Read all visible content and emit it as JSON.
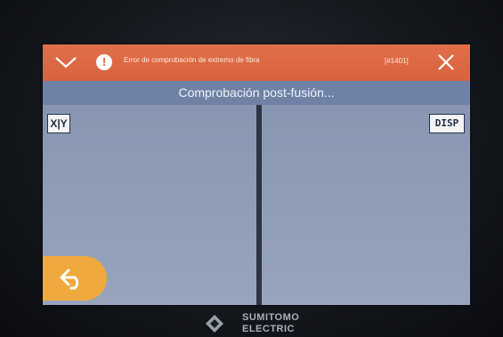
{
  "error_bar": {
    "icon": "chevron-down-icon",
    "warning_icon": "exclamation-circle-icon",
    "warning_glyph": "!",
    "message": "Error de comprobación de extremo de fibra",
    "code": "[#1401]",
    "close_icon": "close-icon",
    "background_color": "#d8623c"
  },
  "status": {
    "title": "Comprobación post-fusión..."
  },
  "toolbar": {
    "xy_label": "X|Y",
    "disp_label": "DISP"
  },
  "back_button": {
    "icon": "back-arrow-icon",
    "color": "#f0a93f"
  },
  "brand": {
    "line1": "SUMITOMO",
    "line2": "ELECTRIC"
  }
}
